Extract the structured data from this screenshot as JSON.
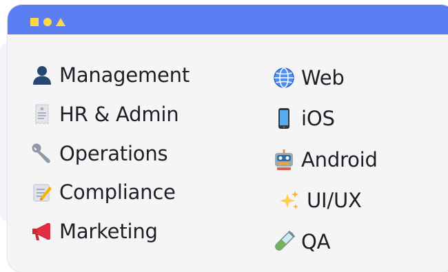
{
  "window": {
    "controls": [
      "square",
      "circle",
      "triangle"
    ],
    "titlebar_color": "#5b7ff3",
    "control_color": "#ffd84a"
  },
  "departments": [
    {
      "label": "Management",
      "icon": "bust-silhouette-icon"
    },
    {
      "label": "HR & Admin",
      "icon": "receipt-icon"
    },
    {
      "label": "Operations",
      "icon": "wrench-icon"
    },
    {
      "label": "Compliance",
      "icon": "memo-icon"
    },
    {
      "label": "Marketing",
      "icon": "megaphone-icon"
    }
  ],
  "platforms": [
    {
      "label": "Web",
      "icon": "globe-icon"
    },
    {
      "label": "iOS",
      "icon": "mobile-phone-icon"
    },
    {
      "label": "Android",
      "icon": "robot-icon"
    },
    {
      "label": "UI/UX",
      "icon": "sparkles-icon"
    },
    {
      "label": "QA",
      "icon": "test-tube-icon"
    }
  ]
}
